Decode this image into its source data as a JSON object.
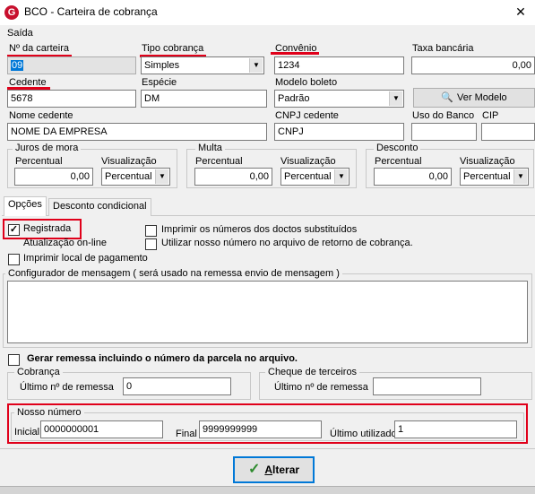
{
  "window": {
    "title": "BCO - Carteira de cobrança",
    "close_glyph": "✕",
    "icon_letter": "G"
  },
  "section": {
    "saida_label": "Saída"
  },
  "fields": {
    "carteira": {
      "label": "Nº da carteira",
      "value": "09"
    },
    "tipo_cobranca": {
      "label": "Tipo cobrança",
      "value": "Simples"
    },
    "convenio": {
      "label": "Convênio",
      "value": "1234"
    },
    "taxa_bancaria": {
      "label": "Taxa bancária",
      "value": "0,00"
    },
    "cedente": {
      "label": "Cedente",
      "value": "5678"
    },
    "especie": {
      "label": "Espécie",
      "value": "DM"
    },
    "modelo_boleto": {
      "label": "Modelo boleto",
      "value": "Padrão"
    },
    "ver_modelo": {
      "label": "Ver Modelo"
    },
    "nome_cedente": {
      "label": "Nome cedente",
      "value": "NOME DA EMPRESA"
    },
    "cnpj_cedente": {
      "label": "CNPJ cedente",
      "value": "CNPJ"
    },
    "uso_banco": {
      "label": "Uso do Banco",
      "value": ""
    },
    "cip": {
      "label": "CIP",
      "value": ""
    }
  },
  "juros": {
    "title": "Juros de mora",
    "percentual_label": "Percentual",
    "percentual_value": "0,00",
    "visualizacao_label": "Visualização",
    "visualizacao_value": "Percentual"
  },
  "multa": {
    "title": "Multa",
    "percentual_label": "Percentual",
    "percentual_value": "0,00",
    "visualizacao_label": "Visualização",
    "visualizacao_value": "Percentual"
  },
  "desconto": {
    "title": "Desconto",
    "percentual_label": "Percentual",
    "percentual_value": "0,00",
    "visualizacao_label": "Visualização",
    "visualizacao_value": "Percentual"
  },
  "tabs": [
    {
      "label": "Opções"
    },
    {
      "label": "Desconto condicional"
    }
  ],
  "options": {
    "registrada": {
      "label": "Registrada",
      "checked": true,
      "mark": "✓"
    },
    "atualizacao": {
      "label": "Atualização on-line"
    },
    "imprimir_local": {
      "label": "Imprimir local de pagamento",
      "checked": false
    },
    "imprimir_numeros": {
      "label": "Imprimir os números dos doctos substituídos",
      "checked": false
    },
    "utilizar_nosso_numero": {
      "label": "Utilizar nosso número no arquivo de retorno de cobrança.",
      "checked": false
    }
  },
  "configurador": {
    "title": "Configurador de mensagem ( será usado na remessa envio de mensagem )",
    "value": ""
  },
  "gerar_remessa": {
    "label": "Gerar remessa incluindo o número da parcela no arquivo.",
    "checked": false
  },
  "cobranca": {
    "title": "Cobrança",
    "ultimo_label": "Último nº  de remessa",
    "ultimo_value": "0"
  },
  "cheque": {
    "title": "Cheque de terceiros",
    "ultimo_label": "Último nº  de remessa",
    "ultimo_value": ""
  },
  "nosso_numero": {
    "title": "Nosso número",
    "inicial_label": "Inicial",
    "inicial_value": "0000000001",
    "final_label": "Final",
    "final_value": "9999999999",
    "ultimo_label": "Último utilizado",
    "ultimo_value": "1"
  },
  "actions": {
    "alterar_label": "Alterar",
    "alterar_underline": "A",
    "alterar_rest": "lterar"
  },
  "colors": {
    "accent": "#0078d7",
    "highlight_red": "#e0001a",
    "check_green": "#2e8b2e"
  }
}
